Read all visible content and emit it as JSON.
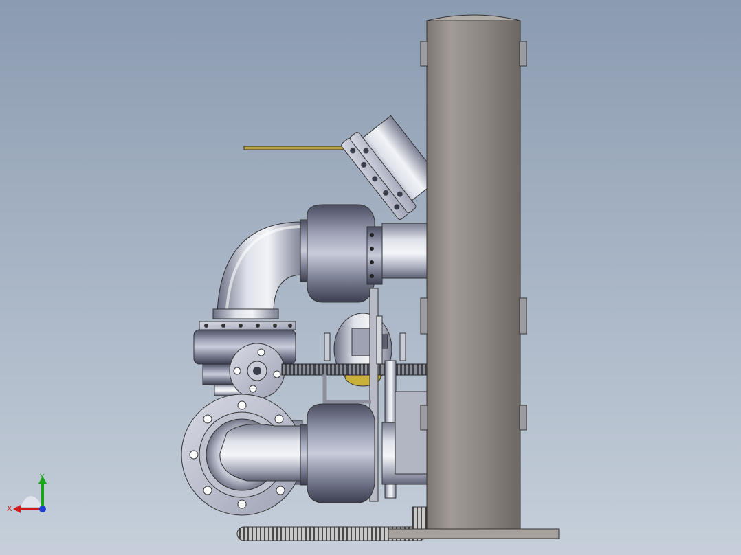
{
  "viewport": {
    "background_top": "#8b9bb0",
    "background_bottom": "#c6cfda"
  },
  "model": {
    "components": [
      "vertical-vessel",
      "angled-flange-nozzle",
      "upper-elbow-pipe",
      "upper-flanged-coupling",
      "valve-body",
      "small-flange",
      "threaded-rod",
      "support-bracket",
      "sight-glass",
      "lower-flange",
      "lower-elbow-pipe",
      "lower-flanged-coupling",
      "base-plate",
      "bottom-spiral-hose",
      "top-rod"
    ],
    "colors": {
      "vessel": "#8f8882",
      "steel": "#c9ccd6",
      "steel_dark": "#6f7385",
      "rod_gold": "#b8a04a",
      "yellow_part": "#c9b23a"
    }
  },
  "triad": {
    "x_label": "X",
    "y_label": "Y",
    "x_color": "#d01c1c",
    "y_color": "#1aa51a",
    "z_color": "#1c3fd0",
    "icon": "coordinate-triad-icon"
  }
}
